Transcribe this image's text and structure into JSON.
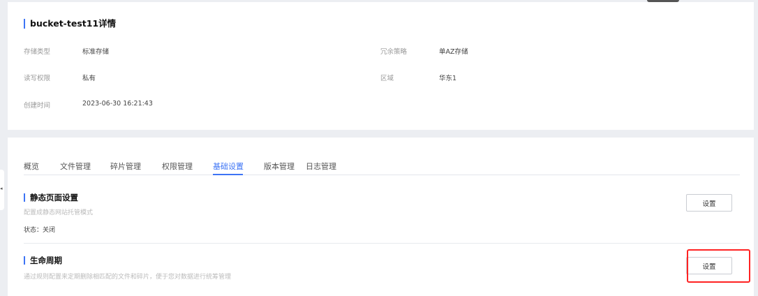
{
  "detail": {
    "title": "bucket-test11详情",
    "fields": [
      {
        "label": "存储类型",
        "value": "标准存储"
      },
      {
        "label": "冗余策略",
        "value": "单AZ存储"
      },
      {
        "label": "读写权限",
        "value": "私有"
      },
      {
        "label": "区域",
        "value": "华东1"
      },
      {
        "label": "创建时间",
        "value": "2023-06-30 16:21:43"
      }
    ]
  },
  "tabs": [
    "概览",
    "文件管理",
    "碎片管理",
    "权限管理",
    "基础设置",
    "版本管理",
    "日志管理"
  ],
  "active_tab": "基础设置",
  "sections": [
    {
      "title": "静态页面设置",
      "desc": "配置成静态网站托管模式",
      "status": "状态：关闭",
      "button": "设置"
    },
    {
      "title": "生命周期",
      "desc": "通过规则配置来定期删除相匹配的文件和碎片，便于您对数据进行统筹管理",
      "button": "设置"
    }
  ],
  "colors": {
    "accent": "#3d74f5",
    "highlight": "#ff2222"
  }
}
